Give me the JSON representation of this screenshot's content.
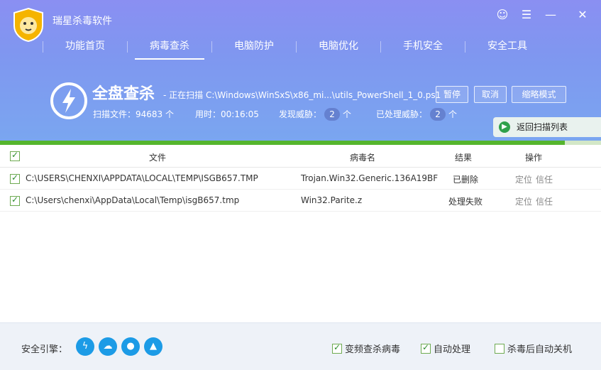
{
  "app": {
    "title": "瑞星杀毒软件"
  },
  "window_controls": [
    {
      "name": "user-icon",
      "glyph": "☺"
    },
    {
      "name": "menu-icon",
      "glyph": "☰"
    },
    {
      "name": "minimize-icon",
      "glyph": "—"
    },
    {
      "name": "close-icon",
      "glyph": "✕"
    }
  ],
  "nav": {
    "items": [
      {
        "label": "功能首页"
      },
      {
        "label": "病毒查杀"
      },
      {
        "label": "电脑防护"
      },
      {
        "label": "电脑优化"
      },
      {
        "label": "手机安全"
      },
      {
        "label": "安全工具"
      }
    ],
    "active_index": 1
  },
  "scan": {
    "title": "全盘查杀",
    "current_path": "- 正在扫描 C:\\Windows\\WinSxS\\x86_mi...\\utils_PowerShell_1_0.ps1",
    "buttons": {
      "pause": "暂停",
      "cancel": "取消",
      "mini": "缩略模式"
    },
    "stats": {
      "files_label": "扫描文件：",
      "files_value": "94683",
      "files_unit": "个",
      "time_label": "用时：",
      "time_value": "00:16:05",
      "threats_label": "发现威胁：",
      "threats_value": "2",
      "threats_unit": "个",
      "handled_label": "已处理威胁：",
      "handled_value": "2",
      "handled_unit": "个"
    },
    "return_label": "返回扫描列表",
    "progress_percent": 94
  },
  "table": {
    "headers": {
      "file": "文件",
      "virus": "病毒名",
      "result": "结果",
      "action": "操作"
    },
    "rows": [
      {
        "file": "C:\\USERS\\CHENXI\\APPDATA\\LOCAL\\TEMP\\ISGB657.TMP",
        "virus": "Trojan.Win32.Generic.136A19BF",
        "result": "已删除",
        "locate": "定位",
        "trust": "信任"
      },
      {
        "file": "C:\\Users\\chenxi\\AppData\\Local\\Temp\\isgB657.tmp",
        "virus": "Win32.Parite.z",
        "result": "处理失败",
        "locate": "定位",
        "trust": "信任"
      }
    ]
  },
  "bottom": {
    "engine_label": "安全引擎：",
    "engine_icons": [
      "lightning-icon",
      "cloud-icon",
      "person-icon",
      "recycle-icon"
    ],
    "options": {
      "frequent_scan": "变频查杀病毒",
      "auto_handle": "自动处理",
      "shutdown_after": "杀毒后自动关机"
    }
  },
  "colors": {
    "header_top": "#8a8ff2",
    "header_bottom": "#7aa6f0",
    "progress": "#55b52d",
    "accent_blue": "#1c9be6"
  }
}
